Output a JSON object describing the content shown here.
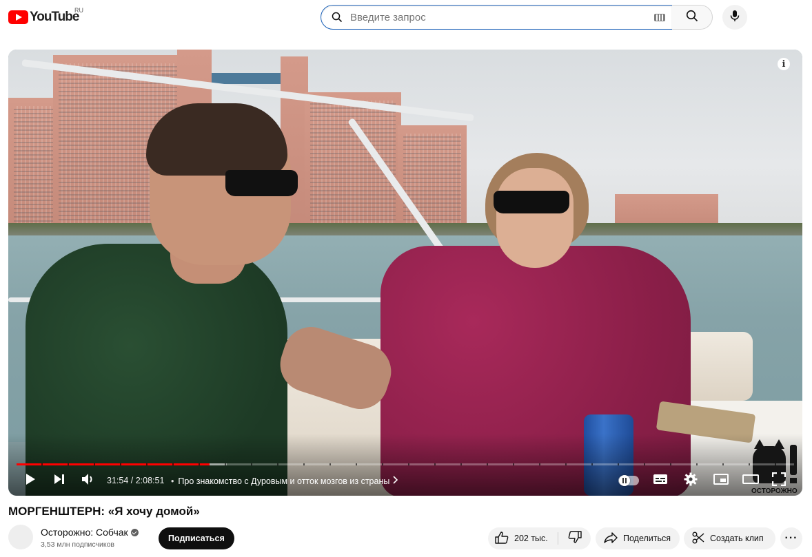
{
  "header": {
    "logo_text": "YouTube",
    "region": "RU",
    "search_placeholder": "Введите запрос"
  },
  "player": {
    "current_time": "31:54 / 2:08:51",
    "chapter_separator": "•",
    "chapter_title": "Про знакомство с Дуровым и отток мозгов из страны",
    "progress_played": 0.248,
    "progress_loaded": 0.27,
    "watermark_text": "ОСТОРОЖНО",
    "info_label": "i"
  },
  "video": {
    "title": "МОРГЕНШТЕРН: «Я хочу домой»",
    "channel_name": "Осторожно: Собчак",
    "subscribers": "3,53 млн подписчиков",
    "subscribe_label": "Подписаться",
    "likes": "202 тыс.",
    "share_label": "Поделиться",
    "clip_label": "Создать клип",
    "more_label": "···"
  },
  "colors": {
    "brand_red": "#ff0000",
    "search_focus_border": "#1c62b9",
    "button_bg": "#f2f2f2",
    "subscribe_bg": "#0f0f0f"
  }
}
